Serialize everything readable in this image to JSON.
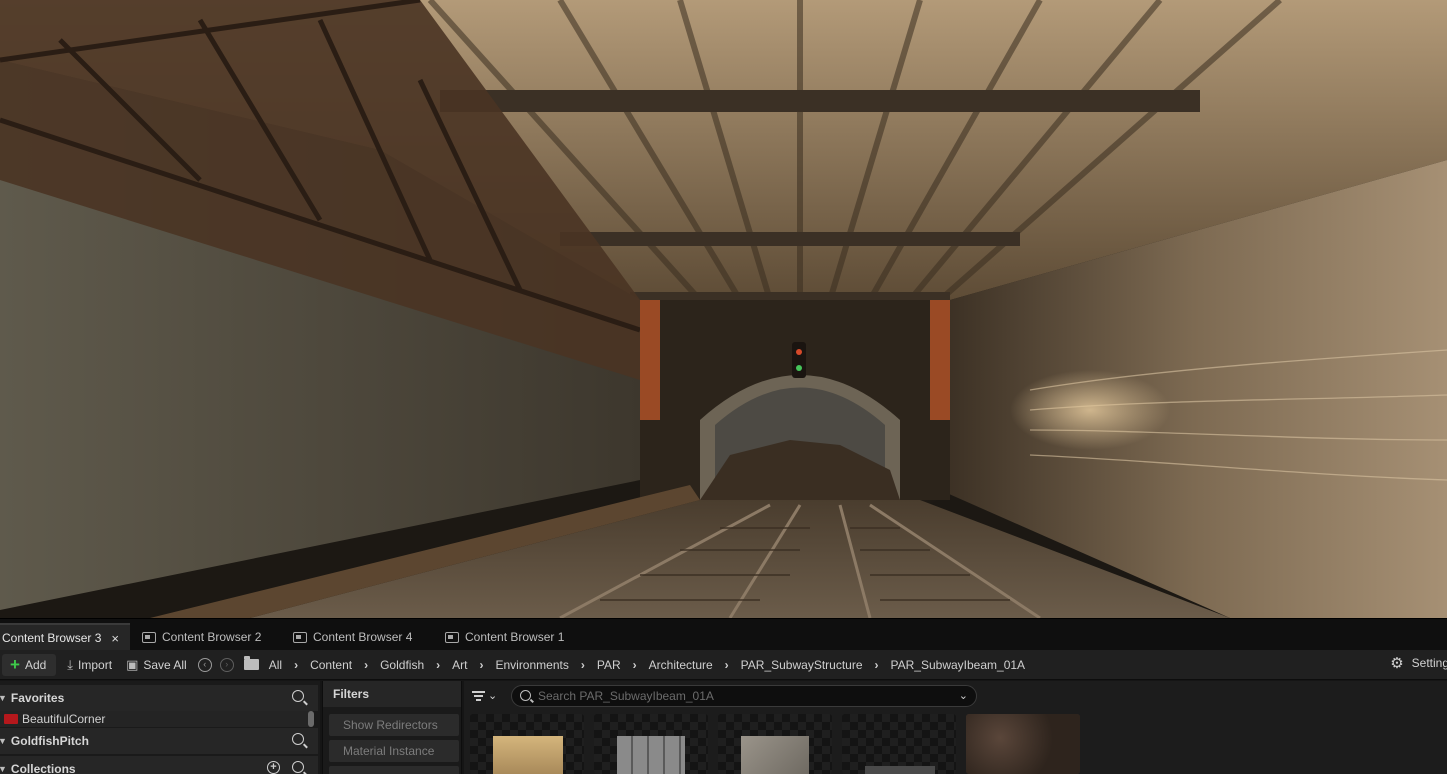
{
  "tabs": [
    {
      "label": "Content Browser 3",
      "active": true,
      "closable": true
    },
    {
      "label": "Content Browser 2",
      "active": false
    },
    {
      "label": "Content Browser 4",
      "active": false
    },
    {
      "label": "Content Browser 1",
      "active": false
    }
  ],
  "toolbar": {
    "add_label": "Add",
    "import_label": "Import",
    "save_all_label": "Save All",
    "settings_label": "Settings"
  },
  "breadcrumb": [
    "All",
    "Content",
    "Goldfish",
    "Art",
    "Environments",
    "PAR",
    "Architecture",
    "PAR_SubwayStructure",
    "PAR_SubwayIbeam_01A"
  ],
  "sidebar": {
    "favorites_label": "Favorites",
    "favorite_items": [
      "BeautifulCorner"
    ],
    "project_label": "GoldfishPitch",
    "collections_label": "Collections"
  },
  "filters": {
    "title": "Filters",
    "chips": [
      "Show Redirectors",
      "Material Instance"
    ]
  },
  "search": {
    "placeholder": "Search PAR_SubwayIbeam_01A"
  },
  "colors": {
    "accent_green": "#3ec94a",
    "favorite_folder_red": "#b5181c",
    "panel_bg": "#1a1a1a"
  }
}
